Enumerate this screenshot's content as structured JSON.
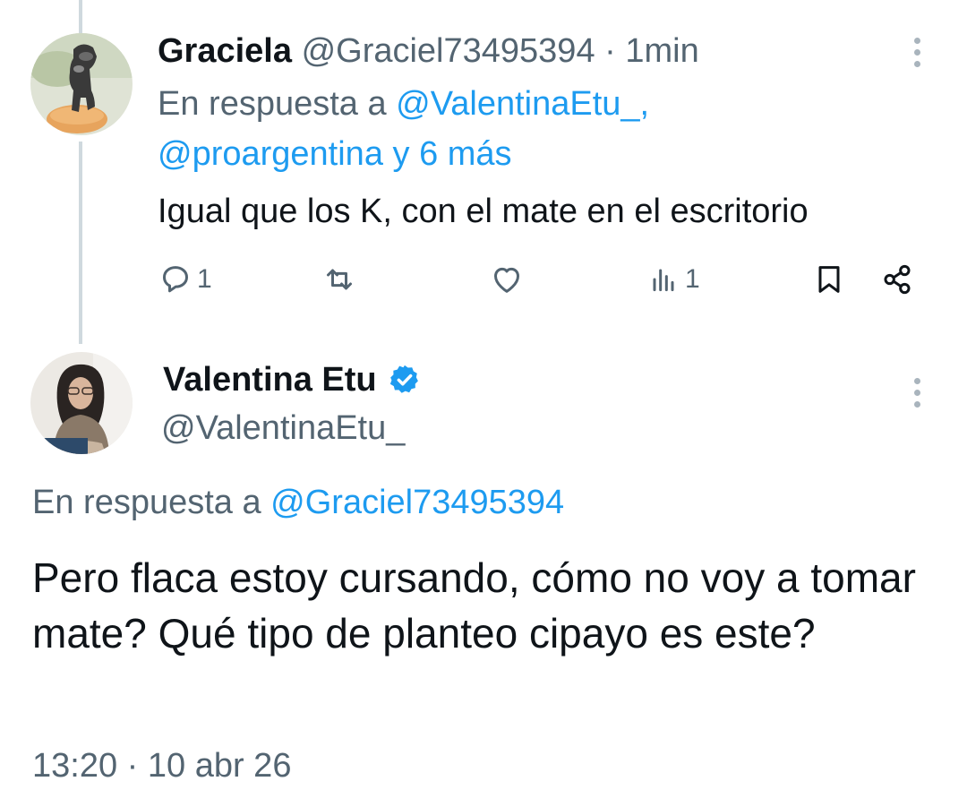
{
  "tweet1": {
    "name": "Graciela",
    "handle": "@Graciel73495394",
    "separator": "·",
    "time": "1min",
    "reply_prefix": "En respuesta a",
    "reply_link1": "@ValentinaEtu_,",
    "reply_link2": "@proargentina y 6 más",
    "text": "Igual que los K, con el mate en el escritorio",
    "replies": "1",
    "views": "1",
    "icons": [
      "reply-icon",
      "retweet-icon",
      "like-icon",
      "views-icon",
      "bookmark-icon",
      "share-icon",
      "more-icon"
    ]
  },
  "tweet2": {
    "name": "Valentina Etu",
    "handle": "@ValentinaEtu_",
    "reply_prefix": "En respuesta a",
    "reply_link": "@Graciel73495394",
    "text": "Pero flaca estoy cursando, cómo no voy a tomar mate? Qué tipo de planteo cipayo es este?",
    "time": "13:20",
    "separator": "·",
    "date": "10 abr 26",
    "icons": [
      "verified-badge-icon",
      "more-icon"
    ]
  },
  "colors": {
    "link": "#1d9bf0",
    "secondary_text": "#536471",
    "primary_text": "#0f1419",
    "thread_line": "#cfd9de",
    "verified": "#1d9bf0"
  }
}
